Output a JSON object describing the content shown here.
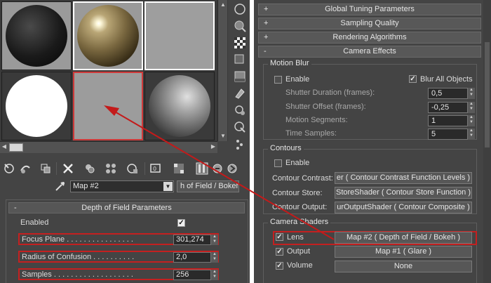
{
  "material_editor": {
    "slots": [
      {
        "material": "black"
      },
      {
        "material": "glossy-gold"
      },
      {
        "material": "gray"
      },
      {
        "material": "white"
      },
      {
        "material": "flat-gray",
        "selected": true
      },
      {
        "material": "glossy-gray"
      }
    ],
    "toolbar_icons": [
      "get-material-icon",
      "put-to-scene-icon",
      "assign-material-icon",
      "reset-map-icon",
      "make-copy-icon",
      "make-unique-icon",
      "put-to-library-icon",
      "material-effects-icon",
      "show-map-icon",
      "show-end-result-icon",
      "go-to-parent-icon",
      "go-forward-icon"
    ],
    "map_name": "Map #2",
    "map_type": "h of Field / Bokeh",
    "rollout": {
      "title": "Depth of Field Parameters",
      "toggle": "-",
      "params": [
        {
          "label": "Enabled",
          "type": "checkbox",
          "checked": true
        },
        {
          "label": "Focus Plane . . . . . . . . . . . . . . . .",
          "value": "301,274"
        },
        {
          "label": "Radius of Confusion . . . . . . . . . .",
          "value": "2,0"
        },
        {
          "label": "Samples . . . . . . . . . . . . . . . . . . .",
          "value": "256"
        }
      ]
    }
  },
  "render_setup": {
    "rollouts": [
      {
        "label": "Global Tuning Parameters",
        "toggle": "+"
      },
      {
        "label": "Sampling Quality",
        "toggle": "+"
      },
      {
        "label": "Rendering Algorithms",
        "toggle": "+"
      },
      {
        "label": "Camera Effects",
        "toggle": "-"
      }
    ],
    "motion_blur": {
      "title": "Motion Blur",
      "enable_label": "Enable",
      "enable_checked": false,
      "blur_all_label": "Blur All Objects",
      "blur_all_checked": true,
      "shutter_duration_label": "Shutter Duration (frames):",
      "shutter_duration": "0,5",
      "shutter_offset_label": "Shutter Offset (frames):",
      "shutter_offset": "-0,25",
      "motion_segments_label": "Motion Segments:",
      "motion_segments": "1",
      "time_samples_label": "Time Samples:",
      "time_samples": "5"
    },
    "contours": {
      "title": "Contours",
      "enable_label": "Enable",
      "enable_checked": false,
      "contrast_label": "Contour Contrast:",
      "contrast_value": "er  ( Contour Contrast Function Levels )",
      "store_label": "Contour Store:",
      "store_value": "StoreShader  ( Contour Store Function )",
      "output_label": "Contour Output:",
      "output_value": "urOutputShader  ( Contour Composite )"
    },
    "camera_shaders": {
      "title": "Camera Shaders",
      "lens_label": "Lens",
      "lens_checked": true,
      "lens_value": "Map #2  ( Depth of Field / Bokeh )",
      "output_label": "Output",
      "output_checked": true,
      "output_value": "Map #1  ( Glare )",
      "volume_label": "Volume",
      "volume_checked": true,
      "volume_value": "None"
    }
  },
  "colors": {
    "highlight": "#c42020",
    "panel": "#444444"
  }
}
